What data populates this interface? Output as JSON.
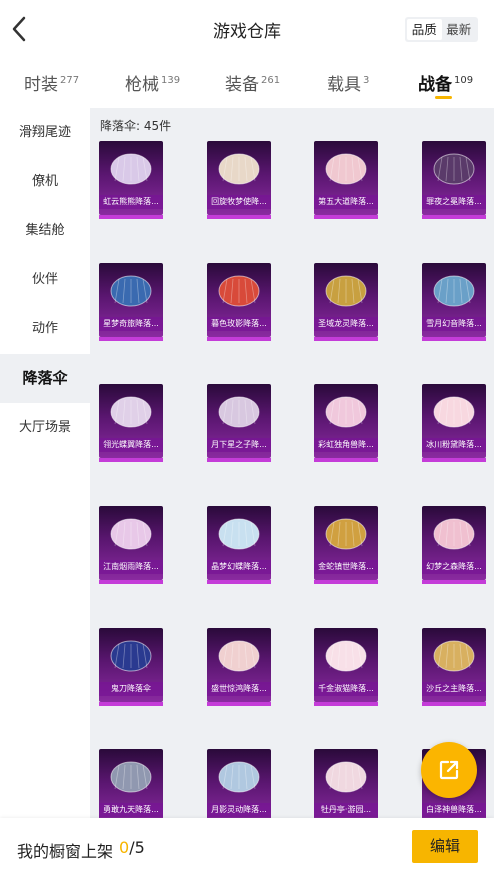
{
  "header": {
    "title": "游戏仓库",
    "sort_options": [
      "品质",
      "最新"
    ],
    "active_sort": "品质"
  },
  "tabs": [
    {
      "label": "时装",
      "count": "277"
    },
    {
      "label": "枪械",
      "count": "139"
    },
    {
      "label": "装备",
      "count": "261"
    },
    {
      "label": "载具",
      "count": "3"
    },
    {
      "label": "战备",
      "count": "109",
      "active": true
    }
  ],
  "sidebar": {
    "items": [
      {
        "label": "滑翔尾迹"
      },
      {
        "label": "僚机"
      },
      {
        "label": "集结舱"
      },
      {
        "label": "伙伴"
      },
      {
        "label": "动作"
      },
      {
        "label": "降落伞",
        "active": true
      },
      {
        "label": "大厅场景"
      }
    ]
  },
  "content": {
    "count_label": "降落伞: 45件",
    "items": [
      {
        "name": "虹云熊熊降落...",
        "color": "#d9c9e8"
      },
      {
        "name": "回旋牧梦使降...",
        "color": "#e8d8c8"
      },
      {
        "name": "第五大道降落...",
        "color": "#f0c8d0"
      },
      {
        "name": "罪夜之冕降落...",
        "color": "#5a3a6a"
      },
      {
        "name": "星梦奇旅降落...",
        "color": "#3a6ab0"
      },
      {
        "name": "暮色玫影降落...",
        "color": "#d84a3a"
      },
      {
        "name": "圣域龙灵降落...",
        "color": "#c8a040"
      },
      {
        "name": "雪月幻音降落...",
        "color": "#6aa0c8"
      },
      {
        "name": "翎光蝶翼降落...",
        "color": "#e0d0e8"
      },
      {
        "name": "月下星之子降...",
        "color": "#d8c8e0"
      },
      {
        "name": "彩虹独角兽降...",
        "color": "#f0c8dc"
      },
      {
        "name": "冰川粉黛降落...",
        "color": "#f8d8e0"
      },
      {
        "name": "江南烟雨降落...",
        "color": "#e8c8e8"
      },
      {
        "name": "晶梦幻蝶降落...",
        "color": "#c8e0f0"
      },
      {
        "name": "金蛇镇世降落...",
        "color": "#d0a040"
      },
      {
        "name": "幻梦之森降落...",
        "color": "#f0c0d0"
      },
      {
        "name": "鬼刀降落伞",
        "color": "#2a3a90"
      },
      {
        "name": "盛世惊鸿降落...",
        "color": "#f0d0d0"
      },
      {
        "name": "千金淑猫降落...",
        "color": "#f8e0e8"
      },
      {
        "name": "沙丘之主降落...",
        "color": "#d8b060"
      },
      {
        "name": "勇敢九天降落...",
        "color": "#9098b0"
      },
      {
        "name": "月影灵动降落...",
        "color": "#b0c8e0"
      },
      {
        "name": "牡丹亭·游园...",
        "color": "#f0d8e0"
      },
      {
        "name": "白泽神兽降落...",
        "color": "#e8d8c0"
      }
    ]
  },
  "share_button": {
    "icon": "external-share-icon"
  },
  "bottom_bar": {
    "showcase_label": "我的橱窗上架",
    "current": "0",
    "total": "/5",
    "edit_label": "编辑"
  }
}
